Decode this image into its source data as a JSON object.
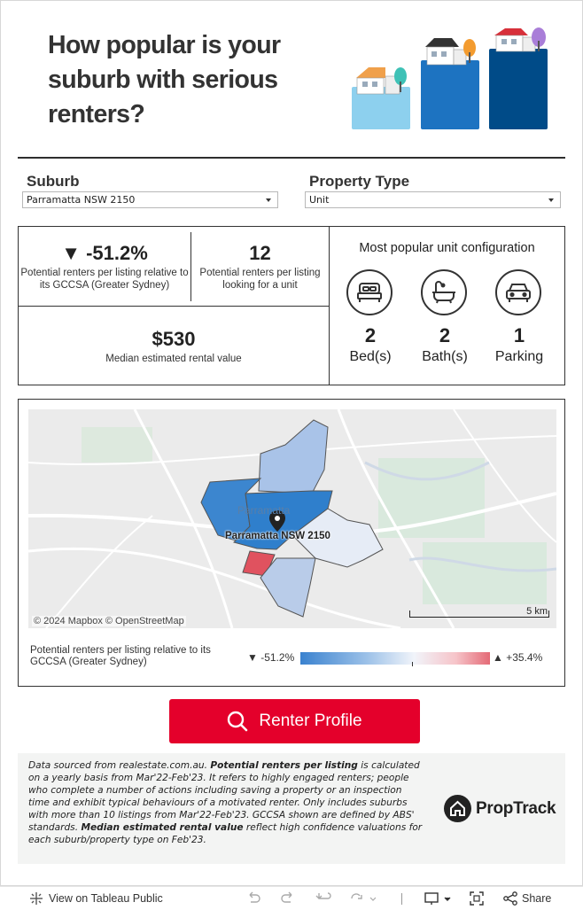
{
  "title": "How popular is your suburb with serious renters?",
  "filters": {
    "suburb_label": "Suburb",
    "suburb_value": "Parramatta NSW 2150",
    "property_label": "Property Type",
    "property_value": "Unit"
  },
  "kpis": {
    "relative_value": "▼ -51.2%",
    "relative_desc": "Potential renters per listing relative to its GCCSA (Greater Sydney)",
    "per_listing_value": "12",
    "per_listing_desc": "Potential renters per listing looking for a unit",
    "rent_value": "$530",
    "rent_desc": "Median estimated rental value"
  },
  "config": {
    "title": "Most popular unit configuration",
    "items": [
      {
        "icon": "bed-icon",
        "value": "2",
        "label": "Bed(s)"
      },
      {
        "icon": "bath-icon",
        "value": "2",
        "label": "Bath(s)"
      },
      {
        "icon": "car-icon",
        "value": "1",
        "label": "Parking"
      }
    ]
  },
  "map": {
    "watermark_label": "Parramatta",
    "pin_label": "Parramatta NSW 2150",
    "attribution": "© 2024 Mapbox  © OpenStreetMap",
    "scale_label": "5 km",
    "legend_label": "Potential renters per listing relative to its GCCSA (Greater Sydney)",
    "legend_min": "▼ -51.2%",
    "legend_max": "▲ +35.4%",
    "colors": {
      "low": "#3a82cf",
      "mid": "#f1f4fa",
      "high": "#e46a76"
    }
  },
  "cta": {
    "label": "Renter Profile",
    "icon": "search-icon"
  },
  "footer": {
    "text_parts": [
      {
        "t": "Data sourced from realestate.com.au. ",
        "b": false
      },
      {
        "t": "Potential renters per listing",
        "b": true
      },
      {
        "t": " is calculated on a yearly basis from Mar'22-Feb'23. It refers to highly engaged renters; people who complete a number of actions including saving a property or an inspection time and exhibit typical behaviours of a motivated renter. Only includes suburbs with more than 10 listings from Mar'22-Feb'23. GCCSA shown are defined by ABS' standards. ",
        "b": false
      },
      {
        "t": "Median estimated rental value",
        "b": true
      },
      {
        "t": " reflect high confidence valuations for each suburb/property type on Feb'23.",
        "b": false
      }
    ],
    "logo_text": "PropTrack"
  },
  "toolbar": {
    "view_label": "View on Tableau Public",
    "share_label": "Share"
  }
}
